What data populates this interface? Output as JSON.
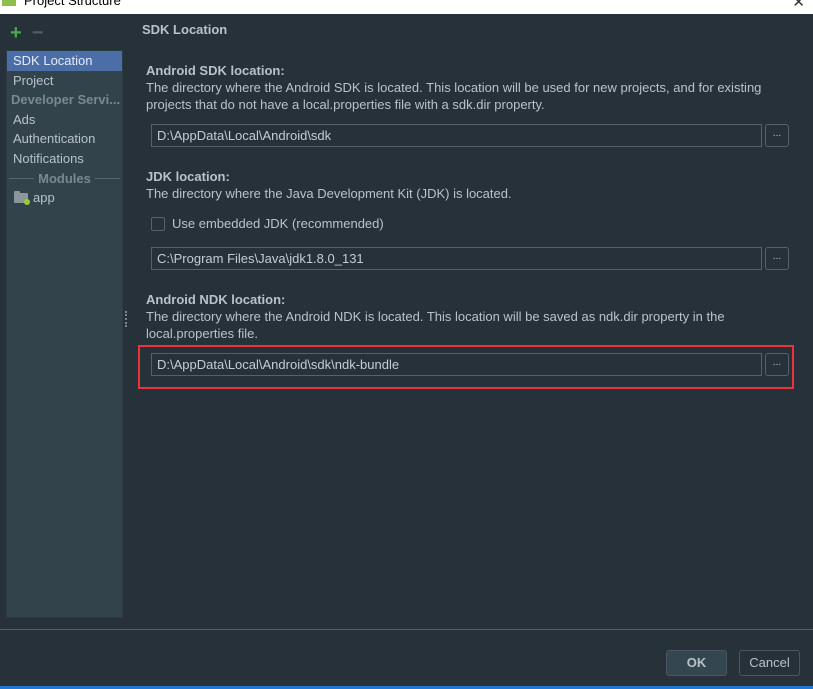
{
  "window": {
    "title": "Project Structure",
    "close_symbol": "✕"
  },
  "toolbar": {
    "add_symbol": "+",
    "remove_symbol": "−"
  },
  "sidebar": {
    "items": [
      {
        "label": "SDK Location",
        "selected": true
      },
      {
        "label": "Project",
        "selected": false
      }
    ],
    "developer_group": "Developer Servi...",
    "developer_items": [
      {
        "label": "Ads"
      },
      {
        "label": "Authentication"
      },
      {
        "label": "Notifications"
      }
    ],
    "modules_label": "Modules",
    "modules": [
      {
        "label": "app"
      }
    ]
  },
  "main": {
    "page_title": "SDK Location",
    "sdk": {
      "title": "Android SDK location:",
      "description": "The directory where the Android SDK is located. This location will be used for new projects, and for existing projects that do not have a local.properties file with a sdk.dir property.",
      "value": "D:\\AppData\\Local\\Android\\sdk",
      "browse_label": "..."
    },
    "jdk": {
      "title": "JDK location:",
      "description": "The directory where the Java Development Kit (JDK) is located.",
      "embedded_checkbox_label": "Use embedded JDK (recommended)",
      "embedded_checked": false,
      "value": "C:\\Program Files\\Java\\jdk1.8.0_131",
      "browse_label": "..."
    },
    "ndk": {
      "title": "Android NDK location:",
      "description": "The directory where the Android NDK is located. This location will be saved as ndk.dir property in the local.properties file.",
      "value": "D:\\AppData\\Local\\Android\\sdk\\ndk-bundle",
      "browse_label": "..."
    }
  },
  "footer": {
    "ok_label": "OK",
    "cancel_label": "Cancel"
  },
  "colors": {
    "highlight": "#e8343a",
    "selection": "#4b6ea8",
    "accent": "#1f7ad4"
  }
}
